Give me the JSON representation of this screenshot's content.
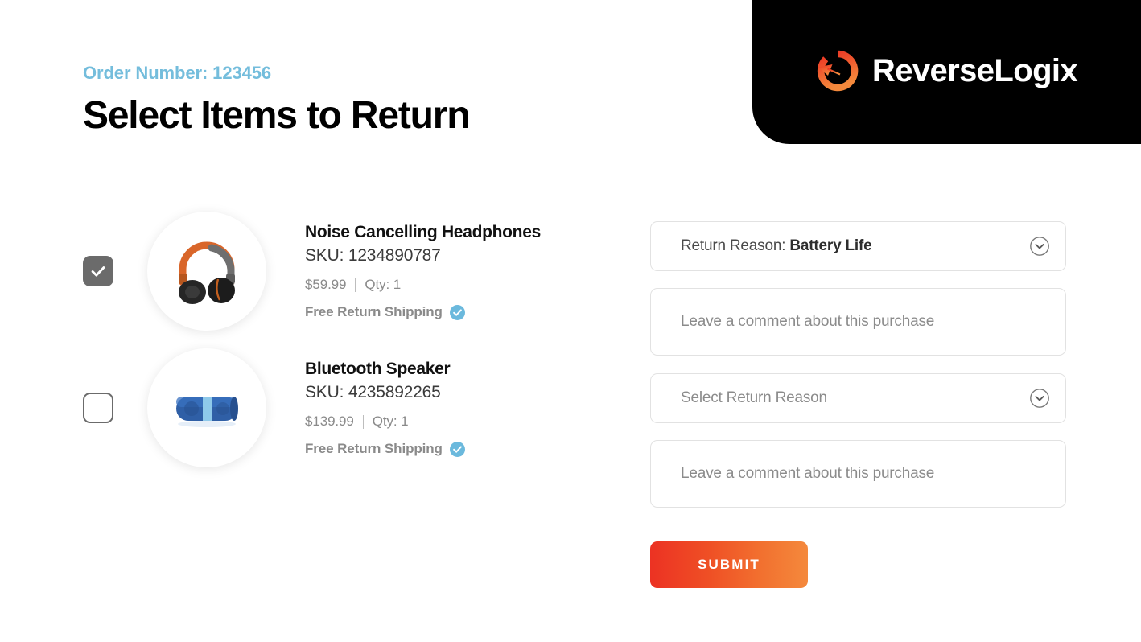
{
  "brand": {
    "name": "ReverseLogix",
    "mark_icon": "circular-return-arrow-icon",
    "panel_color": "#000000",
    "mark_color": "#ec3223",
    "mark_color_secondary": "#f4893c"
  },
  "header": {
    "order_number_label": "Order Number: 123456",
    "title": "Select Items to Return",
    "accent_color": "#74bddc"
  },
  "items": [
    {
      "selected": true,
      "checkbox_icon": "checkmark-icon",
      "image_icon": "headphones-icon",
      "title": "Noise Cancelling Headphones",
      "sku": "SKU: 1234890787",
      "price": "$59.99",
      "qty": "Qty: 1",
      "shipping_label": "Free Return Shipping",
      "shipping_badge_icon": "check-circle-icon"
    },
    {
      "selected": false,
      "checkbox_icon": "checkmark-icon",
      "image_icon": "bluetooth-speaker-icon",
      "title": "Bluetooth Speaker",
      "sku": "SKU: 4235892265",
      "price": "$139.99",
      "qty": "Qty: 1",
      "shipping_label": "Free Return Shipping",
      "shipping_badge_icon": "check-circle-icon"
    }
  ],
  "forms": [
    {
      "reason_prefix": "Return Reason:",
      "reason_value": "Battery Life",
      "reason_placeholder": "",
      "chevron_icon": "chevron-down-circle-icon",
      "comment_placeholder": "Leave a comment about this purchase",
      "comment_value": ""
    },
    {
      "reason_prefix": "",
      "reason_value": "",
      "reason_placeholder": "Select Return Reason",
      "chevron_icon": "chevron-down-circle-icon",
      "comment_placeholder": "Leave a comment about this purchase",
      "comment_value": ""
    }
  ],
  "submit": {
    "label": "SUBMIT",
    "gradient_from": "#ec3223",
    "gradient_to": "#f4893c"
  }
}
